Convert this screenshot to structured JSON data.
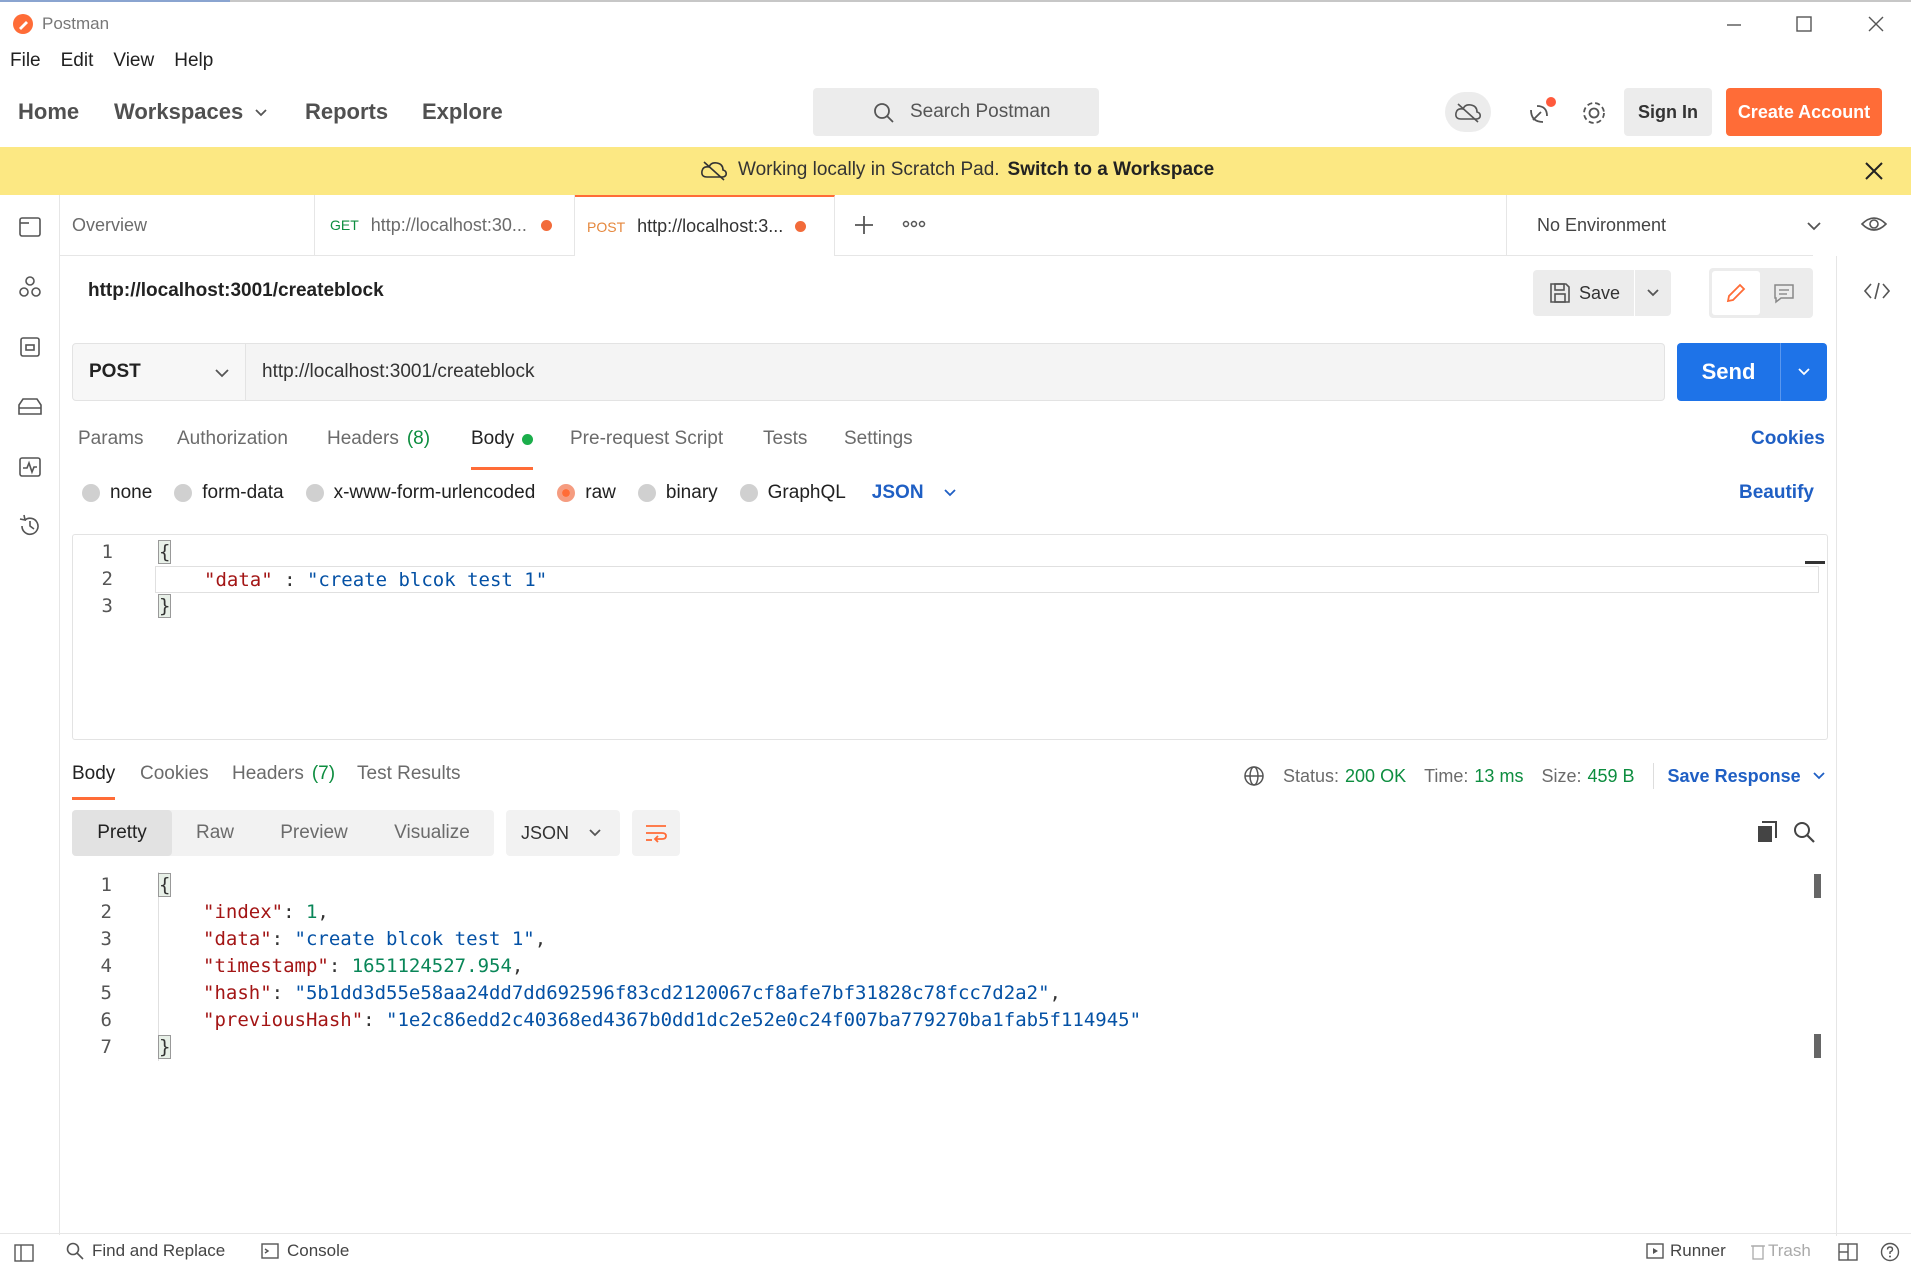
{
  "app": {
    "title": "Postman"
  },
  "menu": [
    "File",
    "Edit",
    "View",
    "Help"
  ],
  "nav": {
    "home": "Home",
    "workspaces": "Workspaces",
    "reports": "Reports",
    "explore": "Explore"
  },
  "search": {
    "placeholder": "Search Postman"
  },
  "header_buttons": {
    "sign_in": "Sign In",
    "create_account": "Create Account"
  },
  "banner": {
    "text": "Working locally in Scratch Pad.",
    "link": "Switch to a Workspace"
  },
  "tabs": [
    {
      "label": "Overview"
    },
    {
      "method": "GET",
      "label": "http://localhost:30...",
      "unsaved": true
    },
    {
      "method": "POST",
      "label": "http://localhost:3...",
      "unsaved": true,
      "active": true
    }
  ],
  "environment": {
    "selected": "No Environment"
  },
  "request": {
    "title": "http://localhost:3001/createblock",
    "method": "POST",
    "url": "http://localhost:3001/createblock",
    "save_label": "Save",
    "send_label": "Send",
    "subtabs": {
      "params": "Params",
      "authorization": "Authorization",
      "headers": "Headers",
      "headers_count": "(8)",
      "body": "Body",
      "prerequest": "Pre-request Script",
      "tests": "Tests",
      "settings": "Settings",
      "cookies": "Cookies"
    },
    "body_types": {
      "none": "none",
      "form_data": "form-data",
      "urlencoded": "x-www-form-urlencoded",
      "raw": "raw",
      "binary": "binary",
      "graphql": "GraphQL",
      "language": "JSON",
      "beautify": "Beautify"
    },
    "body_lines": [
      "1",
      "2",
      "3"
    ],
    "body_code": {
      "open": "{",
      "key": "\"data\"",
      "sep": " : ",
      "value": "\"create blcok test 1\"",
      "close": "}"
    }
  },
  "response": {
    "tabs": {
      "body": "Body",
      "cookies": "Cookies",
      "headers": "Headers",
      "headers_count": "(7)",
      "tests": "Test Results"
    },
    "status_label": "Status:",
    "status": "200 OK",
    "time_label": "Time:",
    "time": "13 ms",
    "size_label": "Size:",
    "size": "459 B",
    "save_response": "Save Response",
    "views": {
      "pretty": "Pretty",
      "raw": "Raw",
      "preview": "Preview",
      "visualize": "Visualize",
      "format": "JSON"
    },
    "lines": [
      "1",
      "2",
      "3",
      "4",
      "5",
      "6",
      "7"
    ],
    "json": {
      "open": "{",
      "index_key": "\"index\"",
      "index_val": "1",
      "data_key": "\"data\"",
      "data_val": "\"create blcok test 1\"",
      "timestamp_key": "\"timestamp\"",
      "timestamp_val": "1651124527.954",
      "hash_key": "\"hash\"",
      "hash_val": "\"5b1dd3d55e58aa24dd7dd692596f83cd2120067cf8afe7bf31828c78fcc7d2a2\"",
      "prev_key": "\"previousHash\"",
      "prev_val": "\"1e2c86edd2c40368ed4367b0dd1dc2e52e0c24f007ba779270ba1fab5f114945\"",
      "close": "}"
    }
  },
  "footer": {
    "find_replace": "Find and Replace",
    "console": "Console",
    "runner": "Runner",
    "trash": "Trash"
  },
  "colors": {
    "brand": "#ff6c37",
    "send": "#1e73e8",
    "banner": "#fce883",
    "status_ok": "#0d8d3f"
  }
}
